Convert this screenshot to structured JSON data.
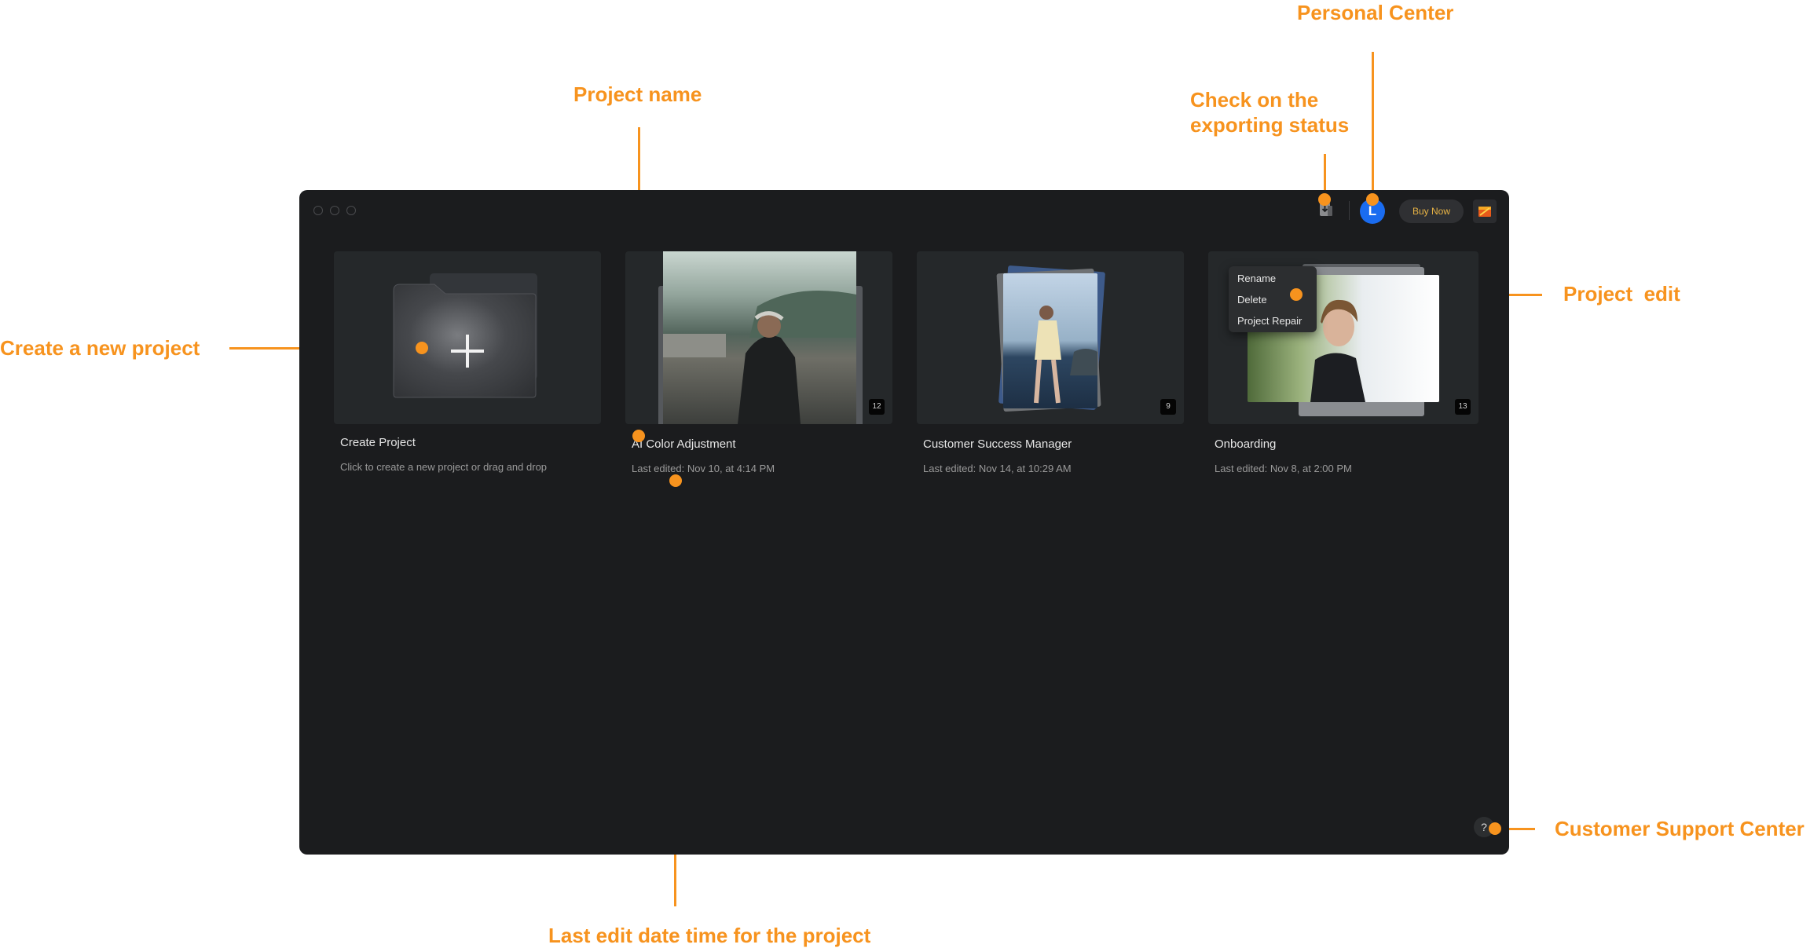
{
  "annotations": {
    "personal_center": "Personal Center",
    "project_name": "Project name",
    "export_status": "Check on the\nexporting status",
    "project_edit": "Project  edit",
    "create_new": "Create a new project",
    "support_center": "Customer Support Center",
    "last_edit": "Last edit date time for the project"
  },
  "header": {
    "avatar_initial": "L",
    "buy_label": "Buy Now",
    "export_icon": "export-status-icon",
    "gift_icon": "gift-icon"
  },
  "create_card": {
    "title": "Create Project",
    "subtitle": "Click to create a new project or drag and drop",
    "icon": "plus-icon"
  },
  "projects": [
    {
      "name": "AI Color Adjustment",
      "last_edited": "Last edited: Nov 10, at 4:14 PM",
      "count": "12"
    },
    {
      "name": "Customer Success Manager",
      "last_edited": "Last edited: Nov 14, at 10:29 AM",
      "count": "9"
    },
    {
      "name": "Onboarding",
      "last_edited": "Last edited: Nov 8, at 2:00 PM",
      "count": "13"
    }
  ],
  "context_menu": {
    "items": [
      "Rename",
      "Delete",
      "Project Repair"
    ]
  },
  "help": {
    "label": "?"
  },
  "colors": {
    "accent": "#F7931E",
    "window_bg": "#1b1c1e",
    "card_bg": "#25282a",
    "avatar": "#1a6cf0",
    "buy_text": "#e9b445"
  }
}
